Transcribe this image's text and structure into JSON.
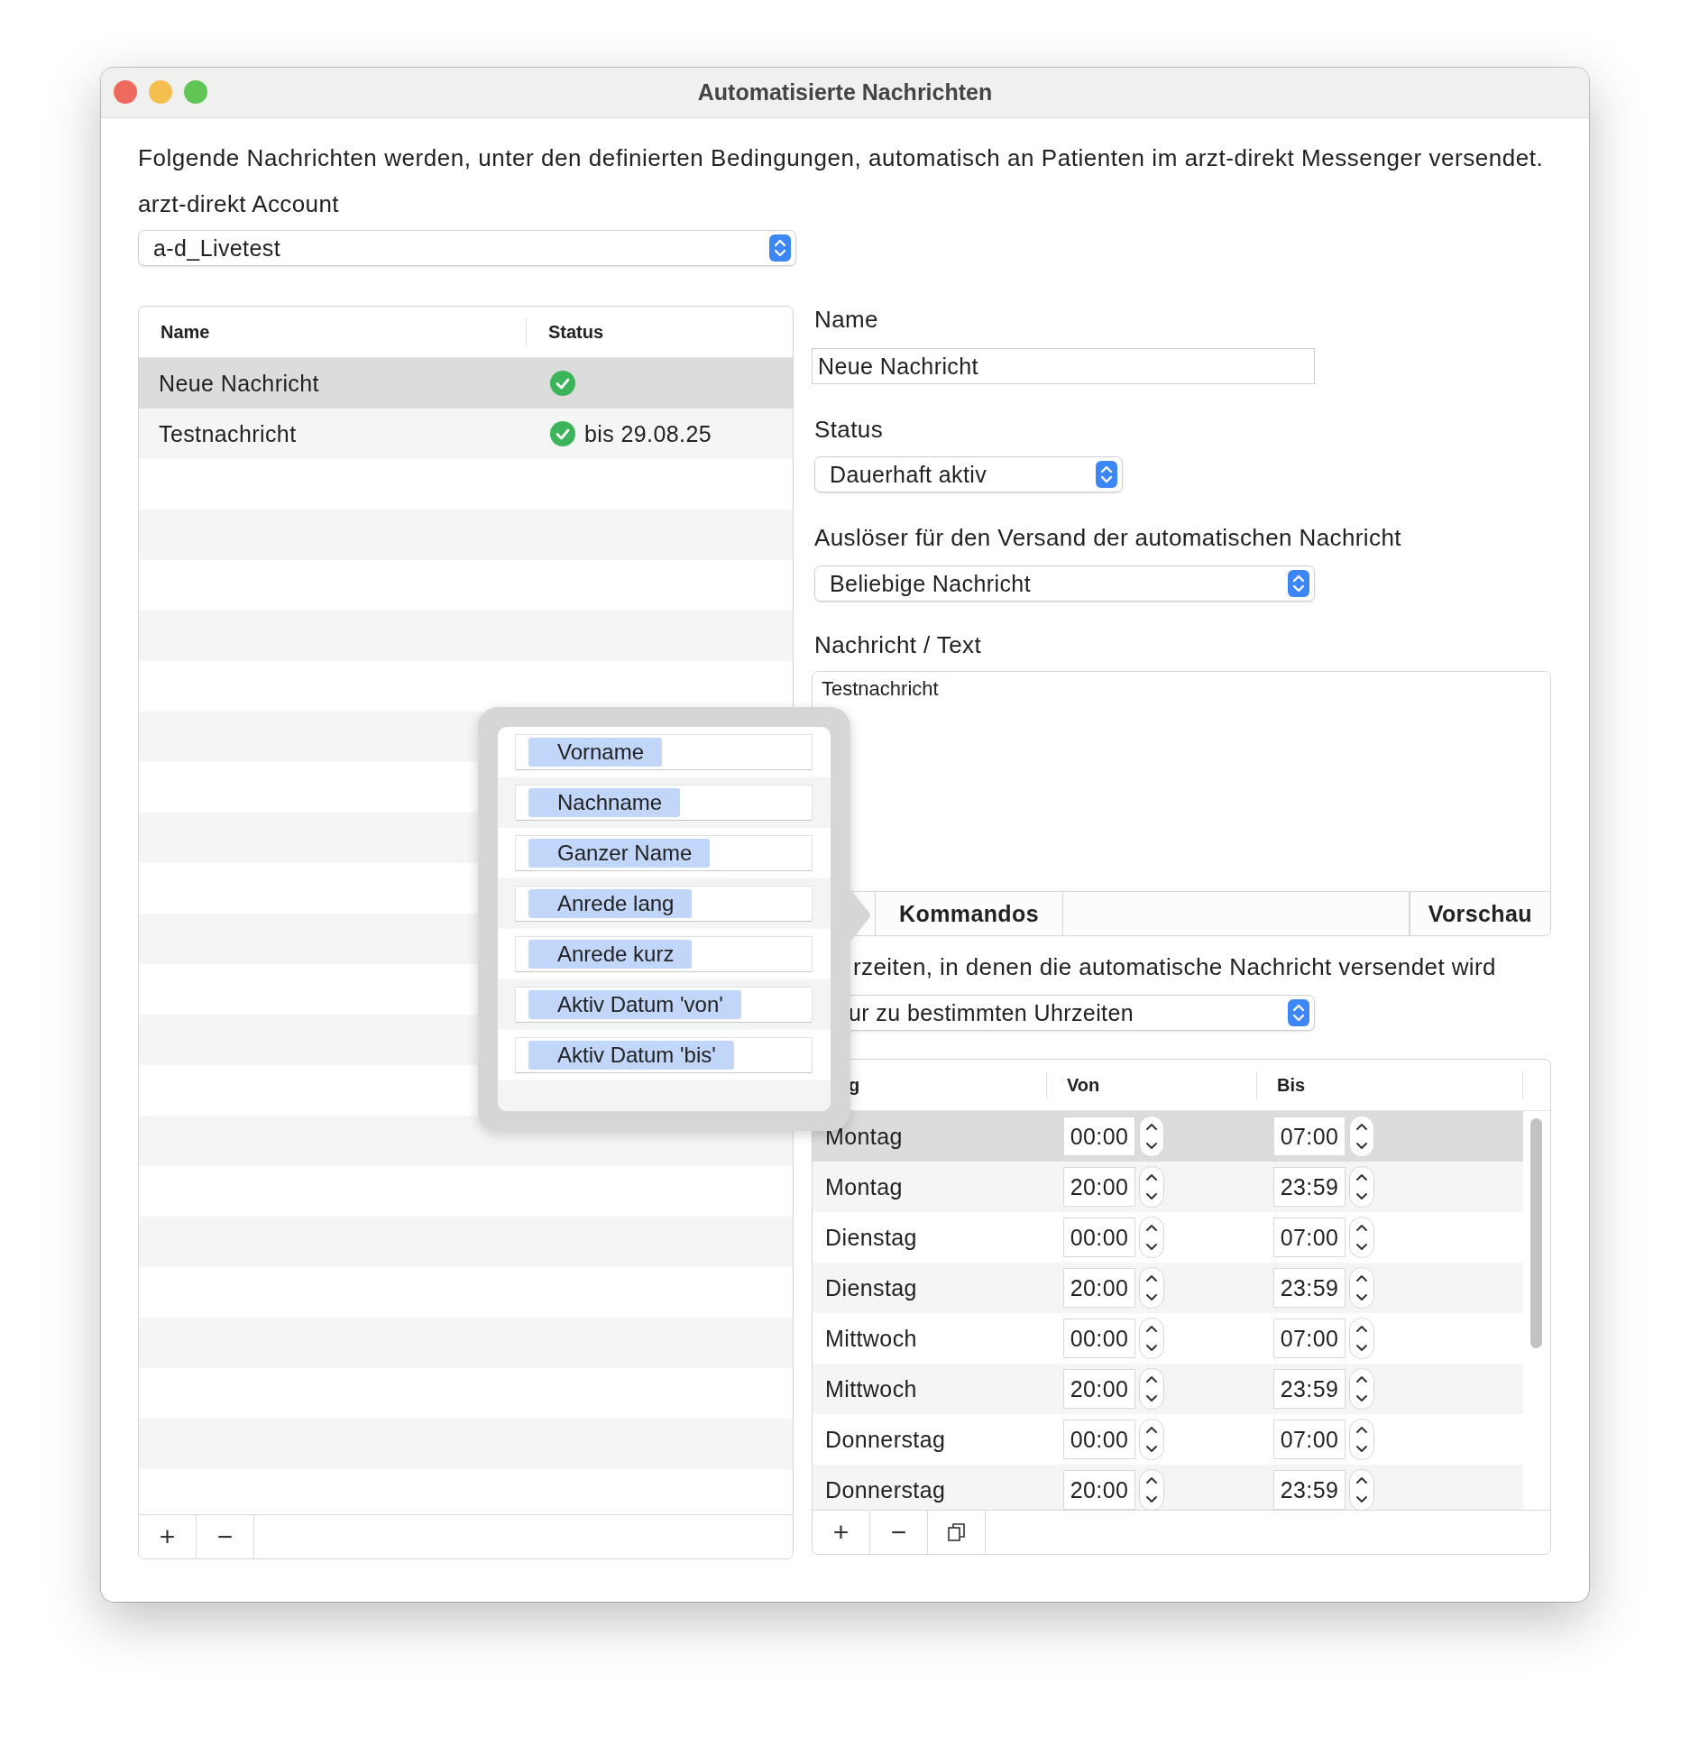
{
  "window": {
    "title": "Automatisierte Nachrichten"
  },
  "intro": "Folgende Nachrichten werden, unter den definierten Bedingungen, automatisch an Patienten im arzt-direkt Messenger versendet.",
  "account": {
    "label": "arzt-direkt Account",
    "value": "a-d_Livetest"
  },
  "messages": {
    "columns": [
      "Name",
      "Status"
    ],
    "rows": [
      {
        "name": "Neue Nachricht",
        "active": true,
        "selected": true
      },
      {
        "name": "Testnachricht",
        "active": true,
        "until": "bis 29.08.25",
        "selected": false
      }
    ],
    "buttons": [
      "+",
      "−"
    ]
  },
  "editor": {
    "name_label": "Name",
    "name_value": "Neue Nachricht",
    "status_label": "Status",
    "status_value": "Dauerhaft aktiv",
    "trigger_label": "Auslöser für den Versand der automatischen Nachricht",
    "trigger_value": "Beliebige Nachricht",
    "text_label": "Nachricht / Text",
    "text_value": "Testnachricht",
    "text_tabs": [
      "Kommandos",
      "Vorschau"
    ],
    "schedule_label": "rzeiten, in denen die automatische Nachricht versendet wird",
    "schedule_mode": "ur zu bestimmten Uhrzeiten"
  },
  "schedule": {
    "columns": [
      "g",
      "Von",
      "Bis"
    ],
    "rows": [
      {
        "day": "Montag",
        "from": "00:00",
        "to": "07:00",
        "selected": true
      },
      {
        "day": "Montag",
        "from": "20:00",
        "to": "23:59",
        "selected": false
      },
      {
        "day": "Dienstag",
        "from": "00:00",
        "to": "07:00",
        "selected": false
      },
      {
        "day": "Dienstag",
        "from": "20:00",
        "to": "23:59",
        "selected": false
      },
      {
        "day": "Mittwoch",
        "from": "00:00",
        "to": "07:00",
        "selected": false
      },
      {
        "day": "Mittwoch",
        "from": "20:00",
        "to": "23:59",
        "selected": false
      },
      {
        "day": "Donnerstag",
        "from": "00:00",
        "to": "07:00",
        "selected": false
      },
      {
        "day": "Donnerstag",
        "from": "20:00",
        "to": "23:59",
        "selected": false
      }
    ],
    "buttons": [
      "+",
      "−"
    ]
  },
  "popover": {
    "items": [
      "Vorname",
      "Nachname",
      "Ganzer Name",
      "Anrede lang",
      "Anrede kurz",
      "Aktiv Datum 'von'",
      "Aktiv Datum 'bis'"
    ]
  }
}
